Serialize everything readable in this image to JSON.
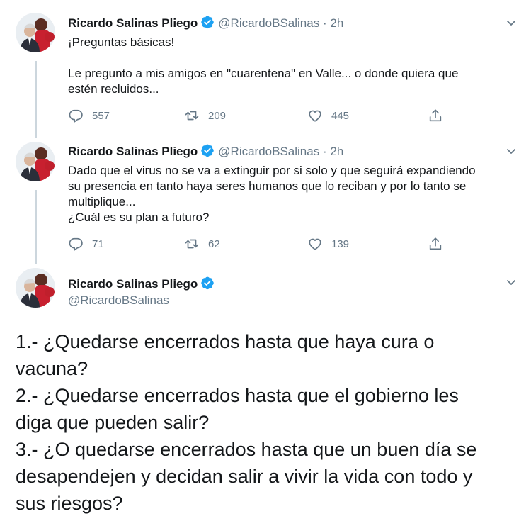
{
  "tweets": [
    {
      "name": "Ricardo Salinas Pliego",
      "handle": "@RicardoBSalinas",
      "separator": "·",
      "time": "2h",
      "lines": [
        "¡Preguntas básicas!",
        "",
        "Le pregunto a mis amigos en \"cuarentena\" en Valle... o donde quiera que",
        "estén recluidos..."
      ],
      "reply_count": "557",
      "retweet_count": "209",
      "like_count": "445"
    },
    {
      "name": "Ricardo Salinas Pliego",
      "handle": "@RicardoBSalinas",
      "separator": "·",
      "time": "2h",
      "lines": [
        "Dado que el virus no se va a extinguir por si solo y que seguirá expandiendo",
        "su presencia en tanto haya seres humanos que lo reciban y por lo tanto se",
        "multiplique...",
        "¿Cuál es su plan a futuro?"
      ],
      "reply_count": "71",
      "retweet_count": "62",
      "like_count": "139"
    },
    {
      "name": "Ricardo Salinas Pliego",
      "handle": "@RicardoBSalinas",
      "lines": [
        "1.- ¿Quedarse encerrados hasta que haya cura o",
        "vacuna?",
        "2.- ¿Quedarse encerrados hasta que el gobierno les",
        "diga que pueden salir?",
        "3.- ¿O quedarse encerrados hasta que un buen día se",
        "desapendejen y decidan salir a vivir la vida con todo y",
        "sus riesgos?"
      ]
    }
  ],
  "icons": {
    "verified": "verified-badge-icon",
    "reply": "speech-bubble-icon",
    "retweet": "retweet-arrows-icon",
    "like": "heart-icon",
    "share": "share-upload-icon",
    "menu": "chevron-down-icon"
  },
  "colors": {
    "verified": "#1da1f2",
    "meta": "#657786",
    "text": "#14171a",
    "thread": "#ccd6dd"
  }
}
